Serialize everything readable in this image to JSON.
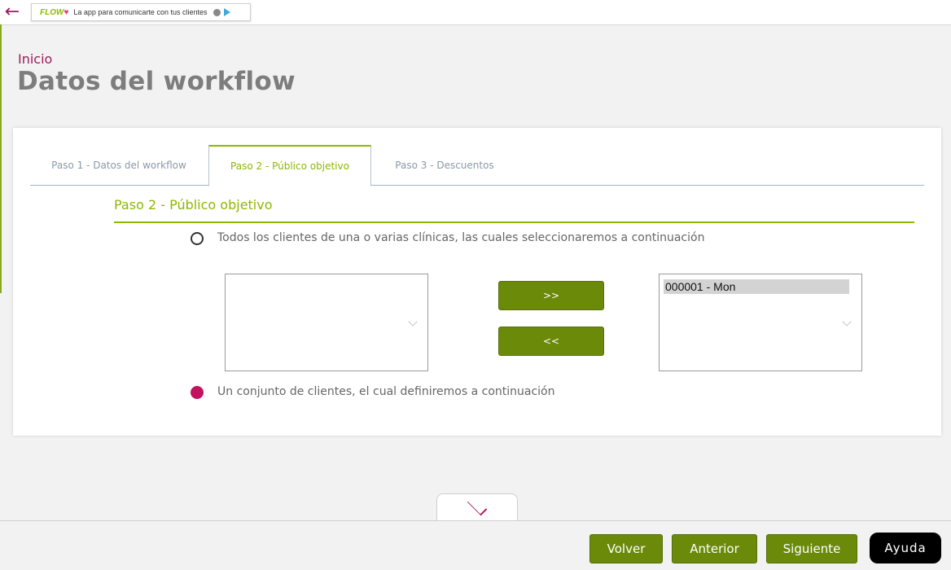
{
  "topbar": {
    "back_icon": "arrow-left-icon",
    "banner": {
      "logo": "FLOW",
      "text": "La app para comunicarte con tus clientes",
      "icons": [
        "apple-icon",
        "google-play-icon"
      ]
    }
  },
  "breadcrumb": "Inicio",
  "page_title": "Datos del workflow",
  "tabs": [
    {
      "label": "Paso 1 - Datos del workflow"
    },
    {
      "label": "Paso 2 - Público objetivo"
    },
    {
      "label": "Paso 3 - Descuentos"
    }
  ],
  "active_tab": "Paso 2 - Público objetivo",
  "section_title": "Paso 2 - Público objetivo",
  "options": {
    "all_clients": "Todos los clientes de una o varias clínicas, las cuales seleccionaremos a continuación",
    "client_set": "Un conjunto de clientes, el cual definiremos a continuación"
  },
  "lists": {
    "available": [],
    "selected": [
      "000001 - Mon"
    ]
  },
  "move_buttons": {
    "add": ">>",
    "remove": "<<"
  },
  "footer": {
    "volver": "Volver",
    "anterior": "Anterior",
    "siguiente": "Siguiente",
    "ayuda": "Ayuda"
  },
  "colors": {
    "accent_green": "#8db800",
    "button_green": "#6b8a0a",
    "brand_magenta": "#9a1d5e",
    "radio_selected": "#c2125f"
  }
}
